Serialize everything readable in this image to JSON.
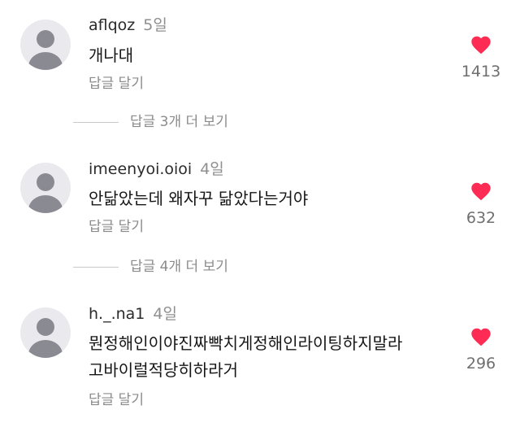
{
  "comments": [
    {
      "username": "aflqoz",
      "time": "5일",
      "text_lines": [
        "개나대"
      ],
      "reply_label": "답글 달기",
      "like_count": "1413",
      "view_replies": "답글 3개 더 보기"
    },
    {
      "username": "imeenyoi.oioi",
      "time": "4일",
      "text_lines": [
        "안닮았는데 왜자꾸 닮았다는거야"
      ],
      "reply_label": "답글 달기",
      "like_count": "632",
      "view_replies": "답글 4개 더 보기"
    },
    {
      "username": "h._.na1",
      "time": "4일",
      "text_lines": [
        "뭔정해인이야진짜빡치게정해인라이팅하지말라",
        "고바이럴적당히하라거"
      ],
      "reply_label": "답글 달기",
      "like_count": "296"
    }
  ],
  "colors": {
    "heart": "#fe2c55",
    "avatar_bg": "#e9e9ee",
    "avatar_fg": "#8a8a93",
    "secondary_text": "#8b8b8b"
  },
  "icons": {
    "avatar": "default-user-icon",
    "like": "heart-icon"
  }
}
